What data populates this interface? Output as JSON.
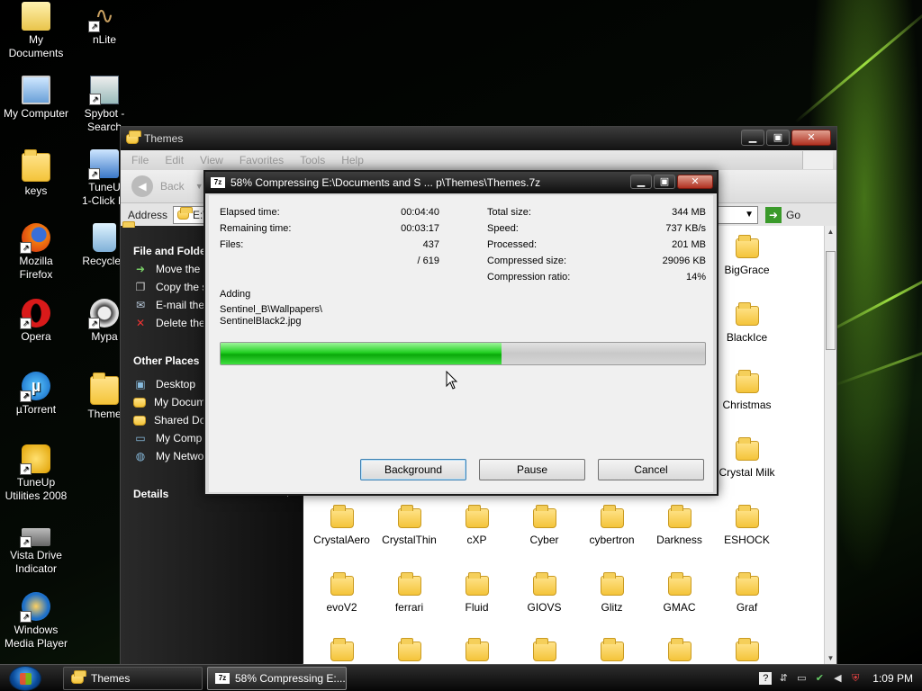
{
  "desktop": {
    "icons": [
      {
        "label": "My\nDocuments",
        "icon": "my-documents-icon"
      },
      {
        "label": "nLite",
        "icon": "nlite-icon"
      },
      {
        "label": "My Computer",
        "icon": "my-computer-icon"
      },
      {
        "label": "Spybot -\nSearch",
        "icon": "spybot-icon"
      },
      {
        "label": "keys",
        "icon": "folder-icon"
      },
      {
        "label": "TuneU\n1-Click M",
        "icon": "tuneup-1click-icon"
      },
      {
        "label": "Mozilla\nFirefox",
        "icon": "firefox-icon"
      },
      {
        "label": "Recycle I",
        "icon": "recycle-bin-icon"
      },
      {
        "label": "Opera",
        "icon": "opera-icon"
      },
      {
        "label": "Mypa",
        "icon": "mypa-icon"
      },
      {
        "label": "µTorrent",
        "icon": "utorrent-icon"
      },
      {
        "label": "Theme",
        "icon": "folder-icon"
      },
      {
        "label": "TuneUp\nUtilities 2008",
        "icon": "tuneup-utilities-icon"
      },
      {
        "label": "Vista Drive\nIndicator",
        "icon": "vista-drive-indicator-icon"
      },
      {
        "label": "Windows\nMedia Player",
        "icon": "windows-media-player-icon"
      }
    ]
  },
  "explorer": {
    "title": "Themes",
    "menu": [
      "File",
      "Edit",
      "View",
      "Favorites",
      "Tools",
      "Help"
    ],
    "back_label": "Back",
    "address_label": "Address",
    "address_value": "E:\\",
    "go_label": "Go",
    "tasks": {
      "file_folder_head": "File and Folder",
      "file_folder_items": [
        "Move the",
        "Copy the s",
        "E-mail the",
        "Delete the"
      ],
      "other_places_head": "Other Places",
      "other_places_items": [
        "Desktop",
        "My Docum",
        "Shared Do",
        "My Comp",
        "My Netwo"
      ],
      "details_head": "Details"
    },
    "folders_right": [
      "BigGrace",
      "BlackIce",
      "Christmas",
      "Crystal Milk"
    ],
    "folders_row1": [
      "CrystalAero",
      "CrystalThin",
      "cXP",
      "Cyber",
      "cybertron",
      "Darkness",
      "ESHOCK"
    ],
    "folders_row2": [
      "evoV2",
      "ferrari",
      "Fluid",
      "GIOVS",
      "Glitz",
      "GMAC",
      "Graf"
    ]
  },
  "dialog": {
    "title": "58% Compressing E:\\Documents and S ... p\\Themes\\Themes.7z",
    "elapsed_label": "Elapsed time:",
    "elapsed_value": "00:04:40",
    "remaining_label": "Remaining time:",
    "remaining_value": "00:03:17",
    "files_label": "Files:",
    "files_value": "437",
    "files_total": "/ 619",
    "total_size_label": "Total size:",
    "total_size_value": "344 MB",
    "speed_label": "Speed:",
    "speed_value": "737 KB/s",
    "processed_label": "Processed:",
    "processed_value": "201 MB",
    "compressed_size_label": "Compressed size:",
    "compressed_size_value": "29096 KB",
    "compression_ratio_label": "Compression ratio:",
    "compression_ratio_value": "14%",
    "status": "Adding",
    "current_path": "Sentinel_B\\Wallpapers\\",
    "current_file": "SentinelBlack2.jpg",
    "progress": 0.58,
    "buttons": {
      "background": "Background",
      "pause": "Pause",
      "cancel": "Cancel"
    }
  },
  "taskbar": {
    "tasks": [
      "Themes",
      "58% Compressing E:..."
    ],
    "clock": "1:09 PM"
  },
  "colors": {
    "progress_green": "#22d022",
    "desktop_accent": "#a0e040"
  }
}
